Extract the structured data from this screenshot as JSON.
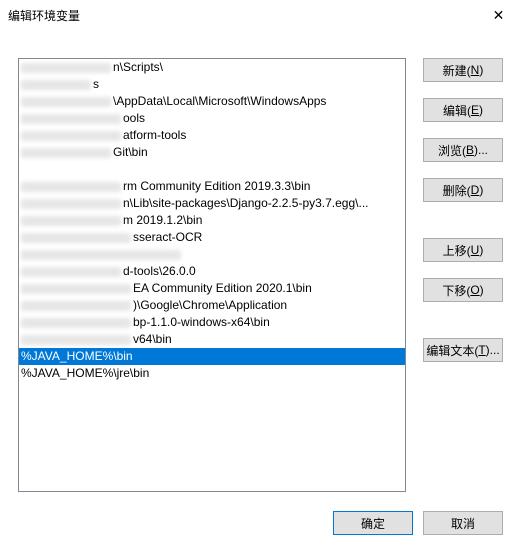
{
  "dialog": {
    "title": "编辑环境变量",
    "close_label": "✕"
  },
  "list": {
    "selected_index": 15,
    "items": [
      {
        "redacted_width": 90,
        "suffix": "n\\Scripts\\"
      },
      {
        "redacted_width": 70,
        "suffix": "s"
      },
      {
        "redacted_width": 90,
        "suffix": "\\AppData\\Local\\Microsoft\\WindowsApps"
      },
      {
        "redacted_width": 100,
        "suffix": "ools"
      },
      {
        "redacted_width": 100,
        "suffix": "atform-tools"
      },
      {
        "redacted_width": 90,
        "suffix": "Git\\bin"
      },
      {
        "redacted_width": 0,
        "suffix": ""
      },
      {
        "redacted_width": 100,
        "suffix": "rm Community Edition 2019.3.3\\bin"
      },
      {
        "redacted_width": 100,
        "suffix": "n\\Lib\\site-packages\\Django-2.2.5-py3.7.egg\\..."
      },
      {
        "redacted_width": 100,
        "suffix": "m 2019.1.2\\bin"
      },
      {
        "redacted_width": 110,
        "suffix": "sseract-OCR"
      },
      {
        "redacted_width": 160,
        "suffix": ""
      },
      {
        "redacted_width": 100,
        "suffix": "d-tools\\26.0.0"
      },
      {
        "redacted_width": 110,
        "suffix": "EA Community Edition 2020.1\\bin"
      },
      {
        "redacted_width": 110,
        "suffix": ")\\Google\\Chrome\\Application"
      },
      {
        "redacted_width": 110,
        "suffix": "bp-1.1.0-windows-x64\\bin"
      },
      {
        "redacted_width": 110,
        "suffix": "v64\\bin"
      },
      {
        "redacted_width": 0,
        "suffix": "%JAVA_HOME%\\bin"
      },
      {
        "redacted_width": 0,
        "suffix": "%JAVA_HOME%\\jre\\bin"
      }
    ]
  },
  "buttons": {
    "new": {
      "label": "新建",
      "mnemonic": "N"
    },
    "edit": {
      "label": "编辑",
      "mnemonic": "E"
    },
    "browse": {
      "label": "浏览",
      "mnemonic": "B",
      "ellipsis": true
    },
    "delete": {
      "label": "删除",
      "mnemonic": "D"
    },
    "move_up": {
      "label": "上移",
      "mnemonic": "U"
    },
    "move_down": {
      "label": "下移",
      "mnemonic": "O"
    },
    "edit_text": {
      "label": "编辑文本",
      "mnemonic": "T",
      "ellipsis": true
    },
    "ok": {
      "label": "确定"
    },
    "cancel": {
      "label": "取消"
    }
  }
}
